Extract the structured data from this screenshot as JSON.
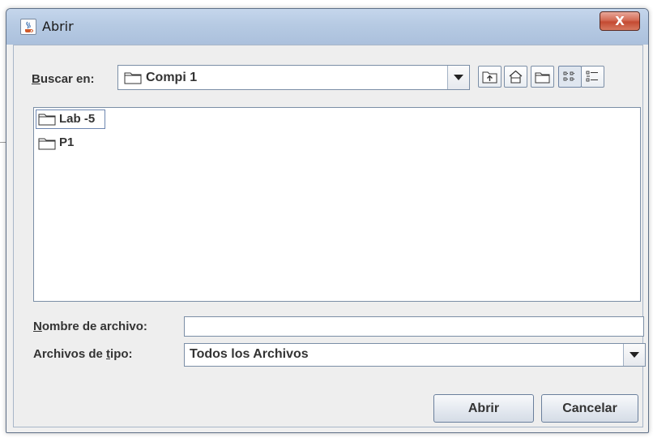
{
  "window": {
    "title": "Abrir",
    "close_label": "X",
    "app_icon": "java-cup-icon"
  },
  "look_in": {
    "label_underline": "B",
    "label_rest": "uscar en:",
    "value": "Compi 1"
  },
  "toolbar": {
    "buttons": [
      "up-one-level-icon",
      "home-icon",
      "new-folder-icon",
      "list-view-icon",
      "details-view-icon"
    ],
    "active": "list-view-icon"
  },
  "files": [
    {
      "name": "Lab -5",
      "selected": true
    },
    {
      "name": "P1",
      "selected": false
    }
  ],
  "file_name": {
    "label_underline": "N",
    "label_rest": "ombre de archivo:",
    "value": ""
  },
  "file_type": {
    "label_before": "Archivos de ",
    "label_underline": "t",
    "label_after": "ipo:",
    "value": "Todos los Archivos"
  },
  "buttons": {
    "open": "Abrir",
    "cancel": "Cancelar"
  },
  "colors": {
    "title_bar": "#b6cae3",
    "close_button": "#c44a32",
    "panel_bg": "#eeeeee",
    "border": "#7b8ea6"
  }
}
